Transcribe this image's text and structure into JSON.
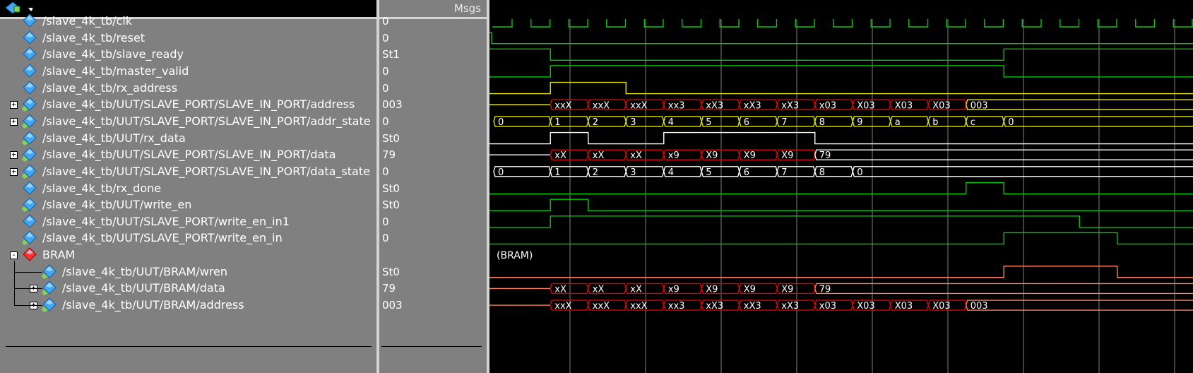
{
  "toolbar": {
    "icon": "signal-add-icon",
    "msgs_label": "Msgs"
  },
  "signals": [
    {
      "name": "/slave_4k_tb/clk",
      "value": "0",
      "type": "wire"
    },
    {
      "name": "/slave_4k_tb/reset",
      "value": "0",
      "type": "wire"
    },
    {
      "name": "/slave_4k_tb/slave_ready",
      "value": "St1",
      "type": "wire"
    },
    {
      "name": "/slave_4k_tb/master_valid",
      "value": "0",
      "type": "wire"
    },
    {
      "name": "/slave_4k_tb/rx_address",
      "value": "0",
      "type": "wire"
    },
    {
      "name": "/slave_4k_tb/UUT/SLAVE_PORT/SLAVE_IN_PORT/address",
      "value": "003",
      "type": "bus"
    },
    {
      "name": "/slave_4k_tb/UUT/SLAVE_PORT/SLAVE_IN_PORT/addr_state",
      "value": "0",
      "type": "bus"
    },
    {
      "name": "/slave_4k_tb/UUT/rx_data",
      "value": "St0",
      "type": "wire"
    },
    {
      "name": "/slave_4k_tb/UUT/SLAVE_PORT/SLAVE_IN_PORT/data",
      "value": "79",
      "type": "bus"
    },
    {
      "name": "/slave_4k_tb/UUT/SLAVE_PORT/SLAVE_IN_PORT/data_state",
      "value": "0",
      "type": "bus"
    },
    {
      "name": "/slave_4k_tb/rx_done",
      "value": "St0",
      "type": "wire"
    },
    {
      "name": "/slave_4k_tb/UUT/write_en",
      "value": "St0",
      "type": "wire"
    },
    {
      "name": "/slave_4k_tb/UUT/SLAVE_PORT/write_en_in1",
      "value": "0",
      "type": "wire"
    },
    {
      "name": "/slave_4k_tb/UUT/SLAVE_PORT/write_en_in",
      "value": "0",
      "type": "wire"
    },
    {
      "name": "BRAM",
      "value": "",
      "type": "group"
    },
    {
      "name": "/slave_4k_tb/UUT/BRAM/wren",
      "value": "St0",
      "type": "wire"
    },
    {
      "name": "/slave_4k_tb/UUT/BRAM/data",
      "value": "79",
      "type": "bus"
    },
    {
      "name": "/slave_4k_tb/UUT/BRAM/address",
      "value": "003",
      "type": "bus"
    }
  ],
  "group_label": "(BRAM)",
  "bus_values": {
    "address": [
      "xxX",
      "xxX",
      "xxX",
      "xx3",
      "xX3",
      "xX3",
      "xX3",
      "x03",
      "X03",
      "X03",
      "X03",
      "003"
    ],
    "addr_state": [
      "0",
      "1",
      "2",
      "3",
      "4",
      "5",
      "6",
      "7",
      "8",
      "9",
      "a",
      "b",
      "c",
      "0"
    ],
    "data": [
      "xX",
      "xX",
      "xX",
      "x9",
      "X9",
      "X9",
      "X9",
      "79"
    ],
    "data_state": [
      "0",
      "1",
      "2",
      "3",
      "4",
      "5",
      "6",
      "7",
      "8",
      "0"
    ],
    "bram_data": [
      "xX",
      "xX",
      "xX",
      "x9",
      "X9",
      "X9",
      "X9",
      "79"
    ],
    "bram_address": [
      "xxX",
      "xxX",
      "xxX",
      "xx3",
      "xX3",
      "xX3",
      "xX3",
      "x03",
      "X03",
      "X03",
      "X03",
      "003"
    ]
  },
  "colors": {
    "wire": "#00cc00",
    "yellow": "#e5e500",
    "white": "#ffffff",
    "red": "#e00000",
    "salmon": "#ff8060",
    "cursor": "#ffffff",
    "panel": "#808080"
  }
}
